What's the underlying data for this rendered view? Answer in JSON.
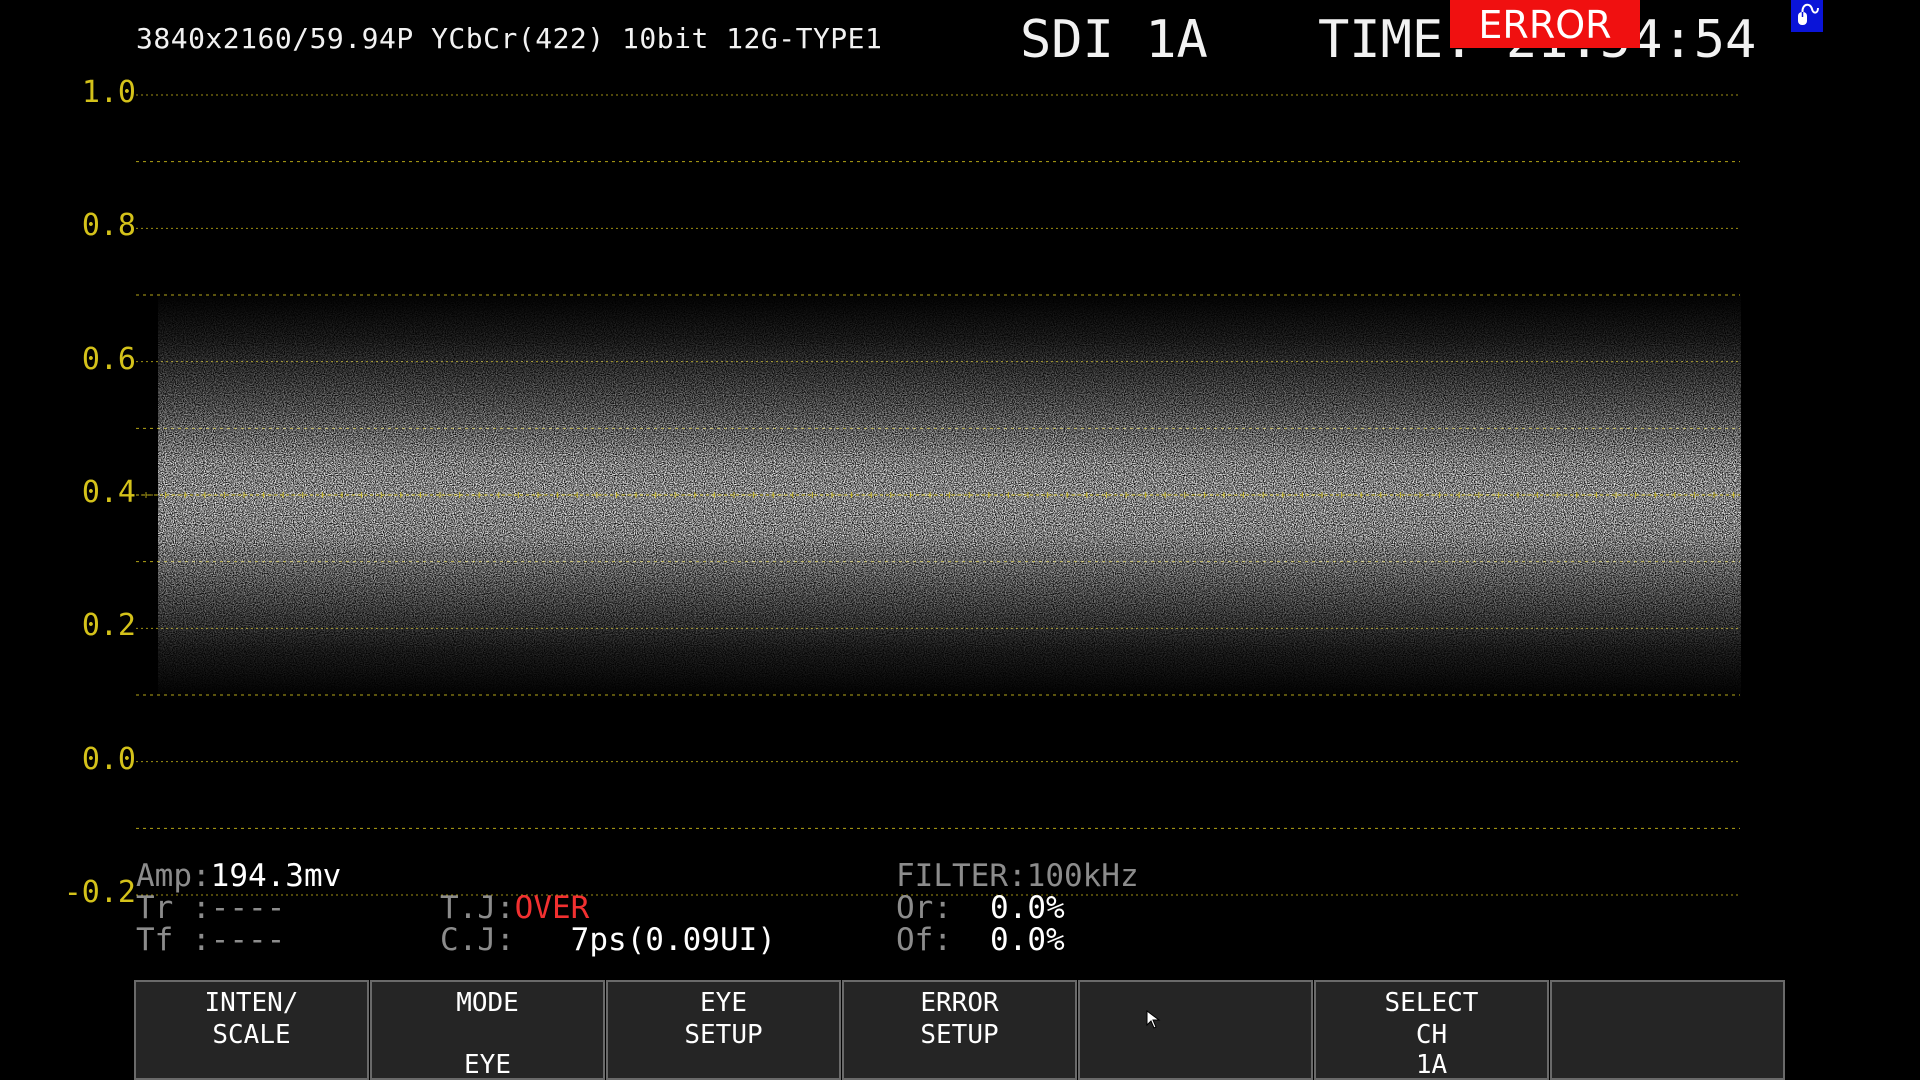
{
  "header": {
    "format": "3840x2160/59.94P YCbCr(422) 10bit 12G-TYPE1",
    "channel": "SDI 1A",
    "time_label": "TIME",
    "time_value": "21:54:54",
    "error_badge": "ERROR"
  },
  "eye": {
    "y_axis": {
      "labels": [
        "1.0",
        "0.8",
        "0.6",
        "0.4",
        "0.2",
        "0.0",
        "-0.2"
      ],
      "min": -0.2,
      "max": 1.0
    },
    "grid_color": "#d4c21a",
    "trace_color": "#ffffff"
  },
  "measurements": {
    "amp_label": "Amp:",
    "amp_value": "194.3mv",
    "tr_label": "Tr :",
    "tr_value": "----",
    "tf_label": "Tf :",
    "tf_value": "----",
    "tj_label": "T.J:",
    "tj_value": "OVER",
    "cj_label": "C.J:",
    "cj_value": "7ps(0.09UI)",
    "filter_label": "FILTER:",
    "filter_value": "100kHz",
    "or_label": "Or:",
    "or_value": "0.0%",
    "of_label": "Of:",
    "of_value": "0.0%"
  },
  "softkeys": [
    {
      "line1": "INTEN/",
      "line2": "SCALE",
      "line3": ""
    },
    {
      "line1": "MODE",
      "line2": "",
      "line3": "EYE"
    },
    {
      "line1": "EYE",
      "line2": "SETUP",
      "line3": ""
    },
    {
      "line1": "ERROR",
      "line2": "SETUP",
      "line3": ""
    },
    {
      "line1": "",
      "line2": "",
      "line3": ""
    },
    {
      "line1": "SELECT",
      "line2": "CH",
      "line3": "1A"
    },
    {
      "line1": "",
      "line2": "",
      "line3": ""
    }
  ],
  "icons": {
    "usb": "usb-mouse-icon",
    "cursor": "mouse-pointer-icon"
  }
}
